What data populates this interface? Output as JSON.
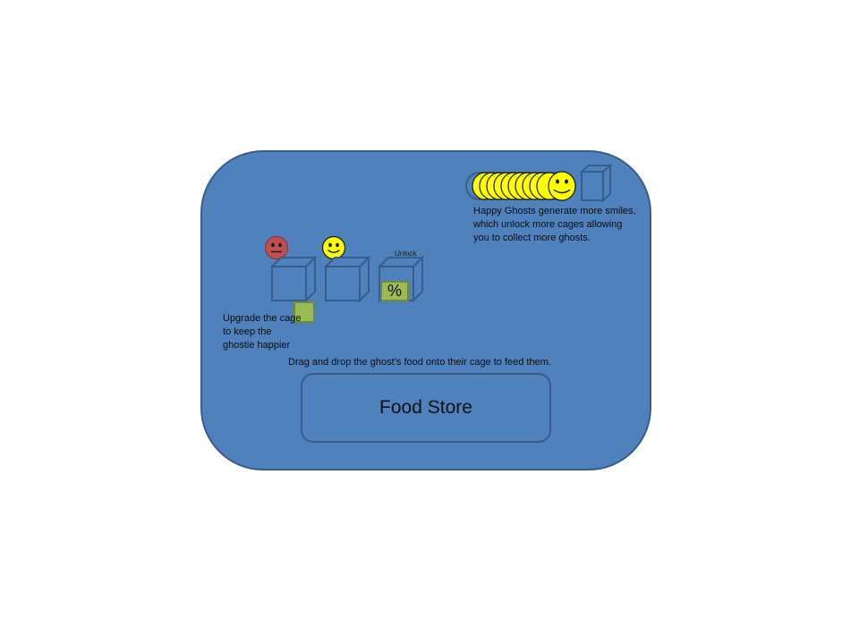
{
  "colors": {
    "panel": "#4f81bd",
    "panel_border": "#385d8a",
    "sad_face": "#c0504d",
    "happy_face": "#ffff00",
    "upgrade_box": "#9bbb59"
  },
  "ghosts": [
    {
      "mood": "sad",
      "icon": "sad-face-icon"
    },
    {
      "mood": "happy",
      "icon": "happy-face-icon"
    }
  ],
  "cages": {
    "unlock_label": "Unlock",
    "percent_symbol": "%"
  },
  "upgrade_note": {
    "lines": [
      "Upgrade the cage",
      "to keep the",
      "ghostie happier"
    ]
  },
  "smile_bar": {
    "icon": "smile-stack-icon"
  },
  "happy_note": {
    "lines": [
      "Happy Ghosts generate more smiles,",
      "which unlock more cages allowing",
      "you to collect more ghosts."
    ]
  },
  "instruction": "Drag and drop the ghost’s food onto their cage to feed them.",
  "food_store": {
    "label": "Food Store"
  }
}
